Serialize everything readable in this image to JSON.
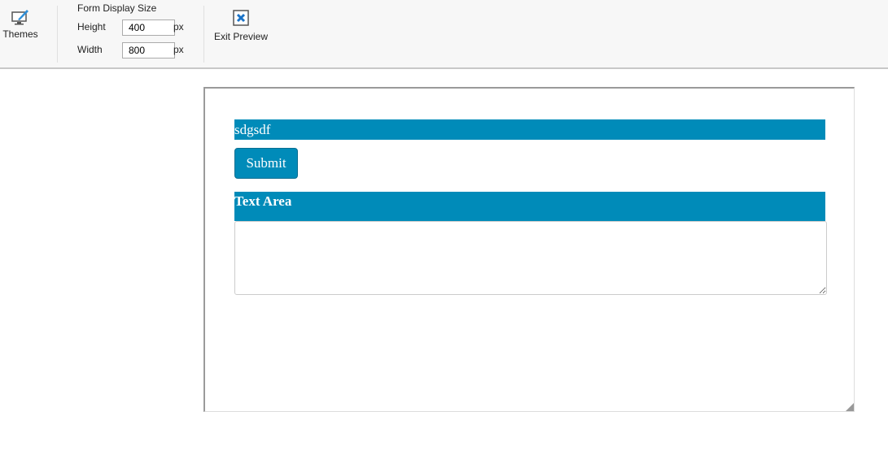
{
  "toolbar": {
    "themes_label": "Themes",
    "form_display_size": {
      "title": "Form Display Size",
      "height_label": "Height",
      "height_value": "400",
      "width_label": "Width",
      "width_value": "800",
      "unit": "px"
    },
    "exit_preview_label": "Exit Preview"
  },
  "form": {
    "header_text": "sdgsdf",
    "submit_label": "Submit",
    "textarea_label": "Text Area",
    "textarea_value": ""
  },
  "colors": {
    "accent": "#008bb9"
  }
}
